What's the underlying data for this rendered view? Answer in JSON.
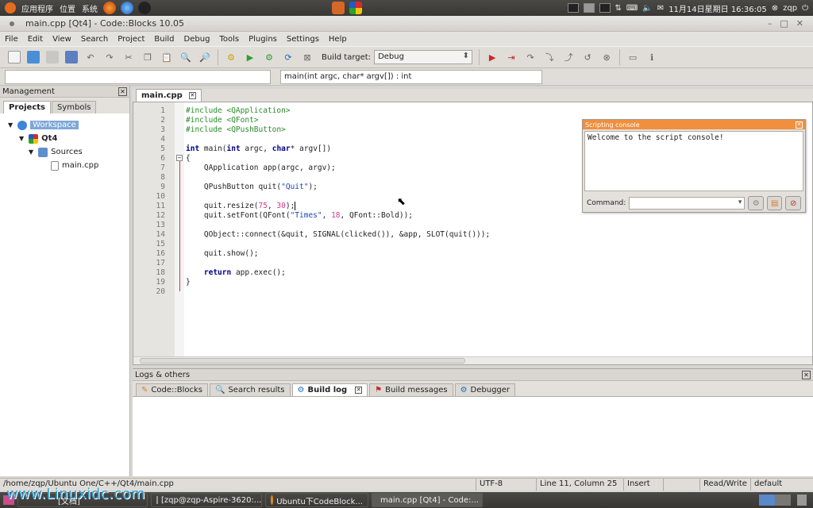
{
  "top_panel": {
    "menus": [
      "应用程序",
      "位置",
      "系统"
    ],
    "clock": "11月14日星期日 16:36:05",
    "user": "zqp"
  },
  "window": {
    "title": "main.cpp [Qt4] - Code::Blocks 10.05"
  },
  "menubar": [
    "File",
    "Edit",
    "View",
    "Search",
    "Project",
    "Build",
    "Debug",
    "Tools",
    "Plugins",
    "Settings",
    "Help"
  ],
  "toolbar": {
    "build_target_label": "Build target:",
    "build_target_value": "Debug"
  },
  "code_completion": {
    "scope": "",
    "function": "main(int argc, char* argv[]) : int"
  },
  "management": {
    "title": "Management",
    "tabs": [
      "Projects",
      "Symbols"
    ],
    "workspace": "Workspace",
    "project": "Qt4",
    "folder": "Sources",
    "file": "main.cpp"
  },
  "editor": {
    "tab_label": "main.cpp",
    "line_numbers": [
      "1",
      "2",
      "3",
      "4",
      "5",
      "6",
      "7",
      "8",
      "9",
      "10",
      "11",
      "12",
      "13",
      "14",
      "15",
      "16",
      "17",
      "18",
      "19",
      "20"
    ]
  },
  "console": {
    "title": "Scripting console",
    "output": "Welcome to the script console!",
    "command_label": "Command:"
  },
  "logs": {
    "title": "Logs & others",
    "tabs": [
      "Code::Blocks",
      "Search results",
      "Build log",
      "Build messages",
      "Debugger"
    ]
  },
  "status_bar": {
    "path": "/home/zqp/Ubuntu One/C++/Qt4/main.cpp",
    "encoding": "UTF-8",
    "position": "Line 11, Column 25",
    "mode": "Insert",
    "access": "Read/Write",
    "lang": "default"
  },
  "taskbar": {
    "items": [
      "[文档]",
      "[zqp@zqp-Aspire-3620:...",
      "Ubuntu下CodeBlock...",
      "main.cpp [Qt4] - Code:..."
    ]
  },
  "watermark": "www.Linuxidc.com"
}
